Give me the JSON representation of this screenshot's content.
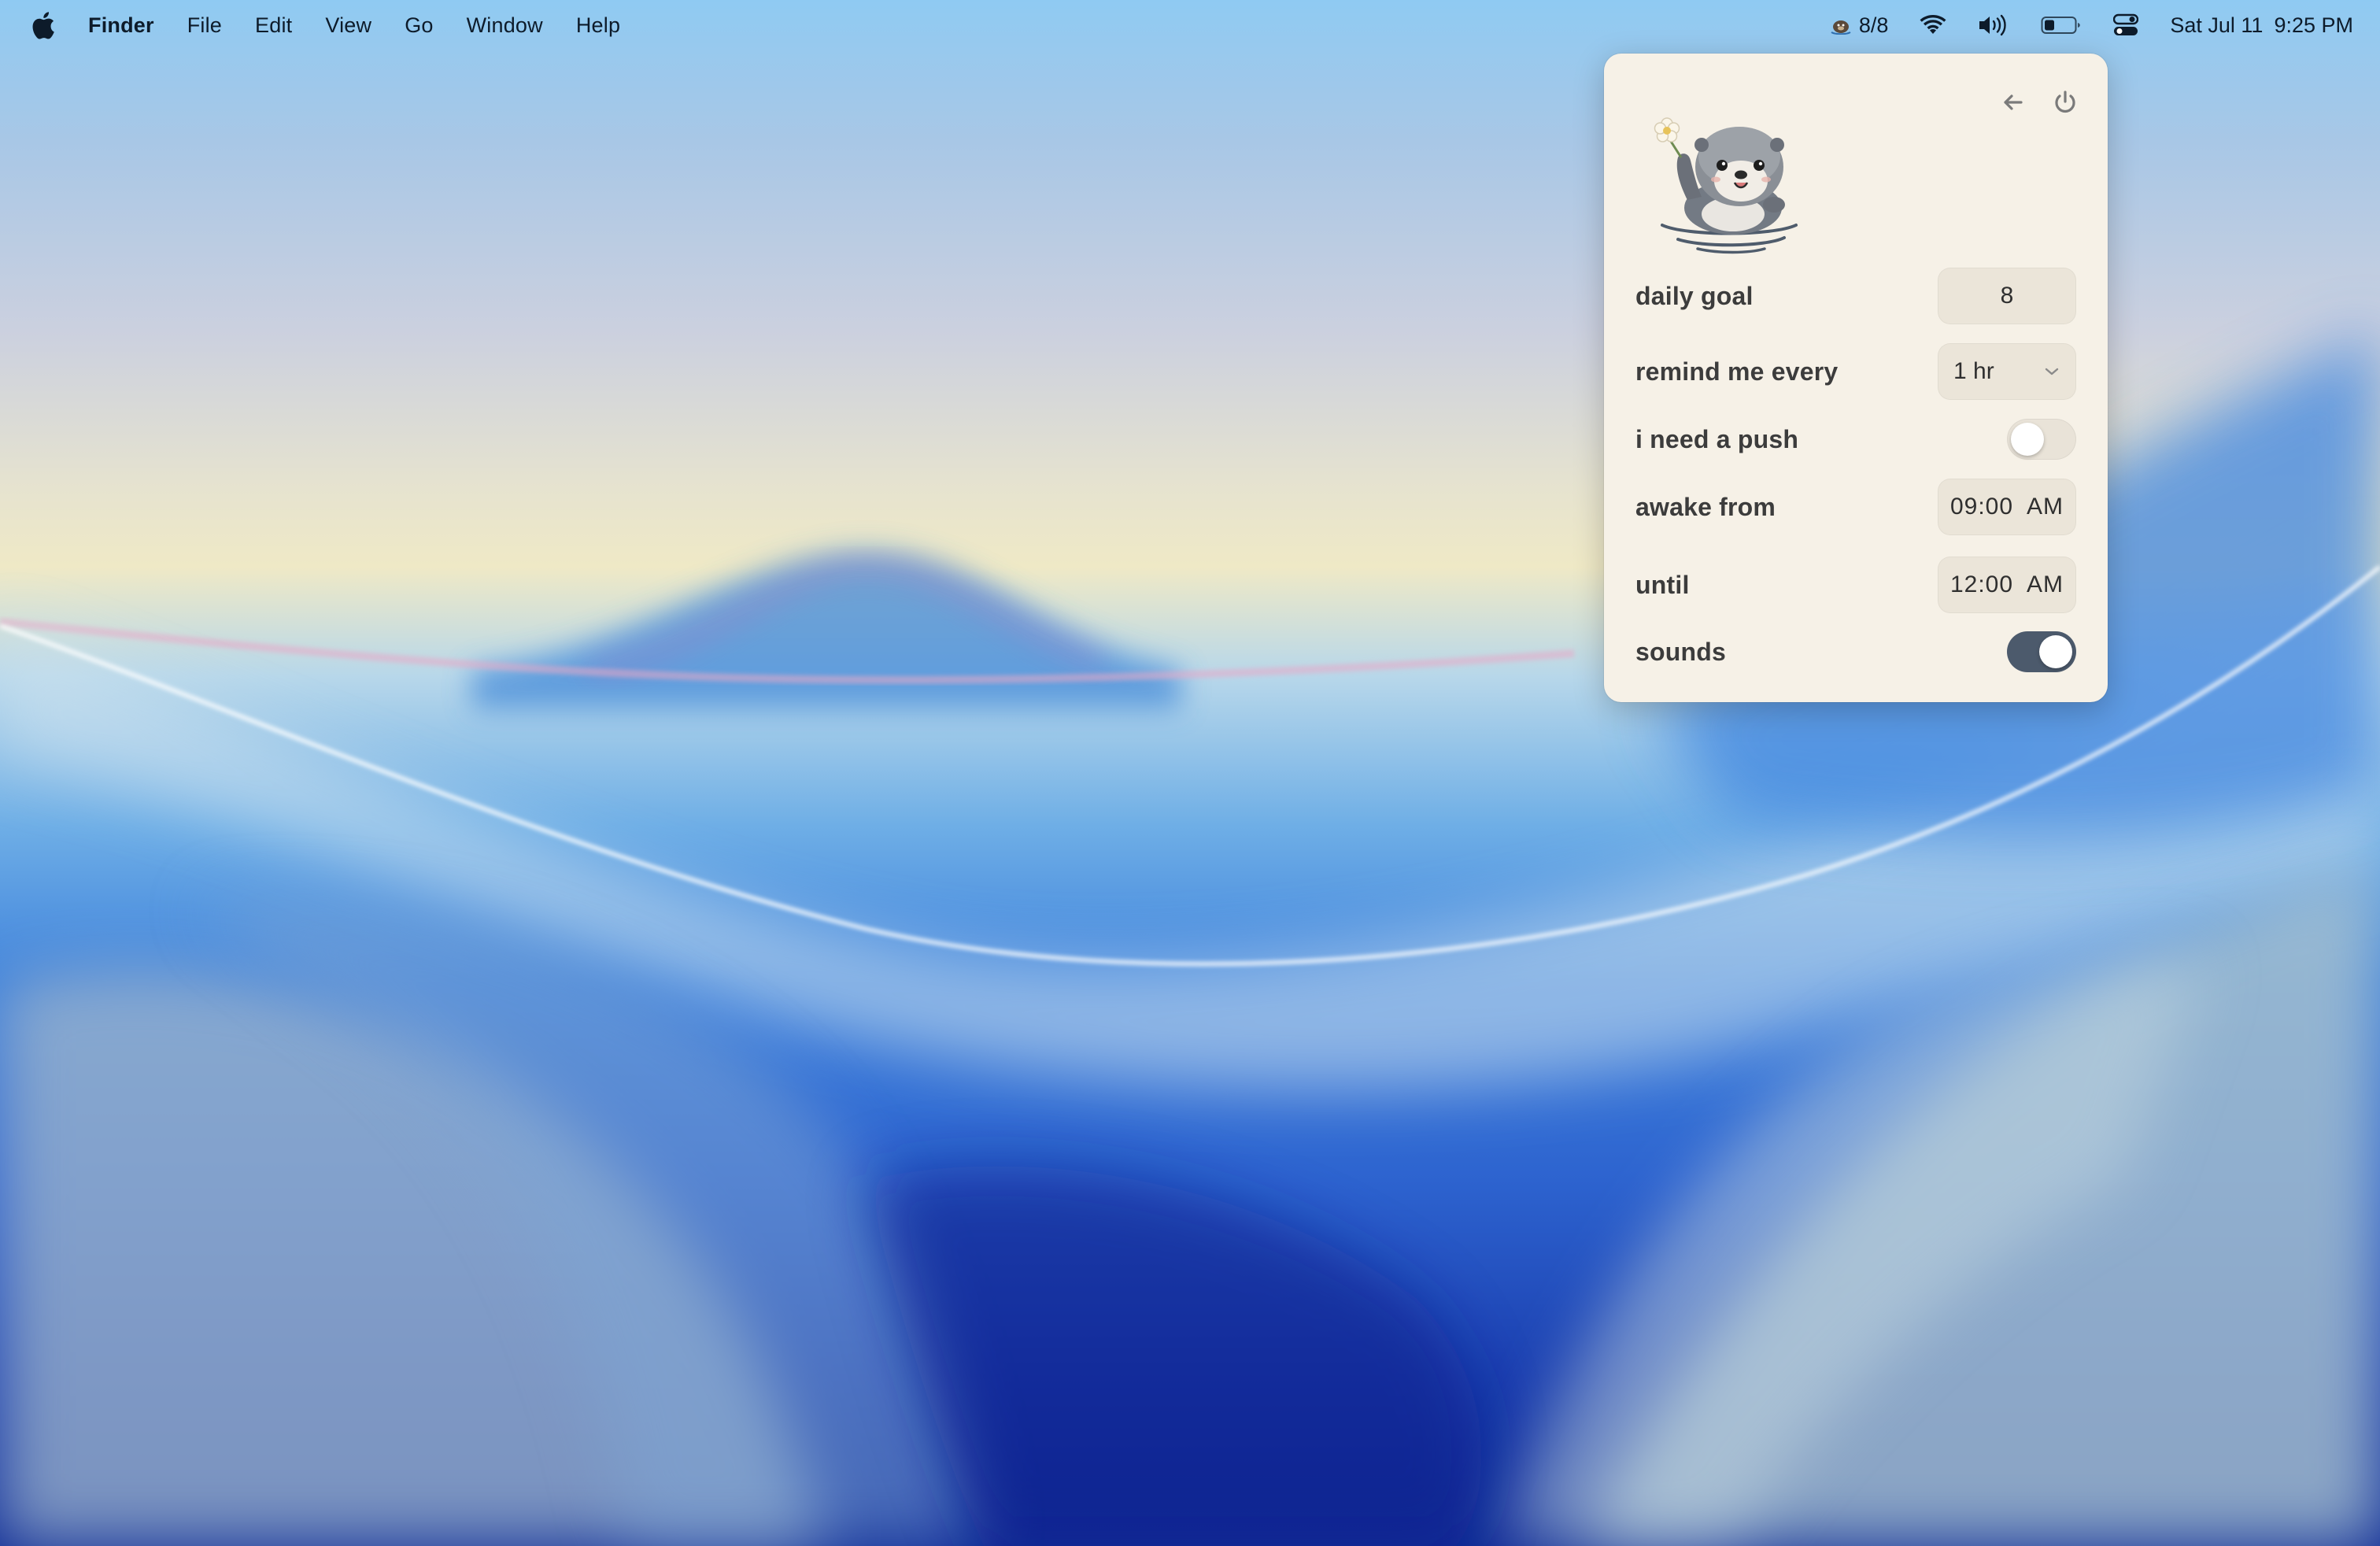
{
  "menubar": {
    "app_name": "Finder",
    "menus": [
      "File",
      "Edit",
      "View",
      "Go",
      "Window",
      "Help"
    ],
    "status_counter": "8/8",
    "date": "Sat Jul 11",
    "time": "9:25 PM",
    "icons": [
      "apple-logo",
      "otter-icon",
      "wifi-icon",
      "volume-icon",
      "battery-icon",
      "control-center-icon"
    ]
  },
  "popover": {
    "mascot": "otter-with-flower",
    "header_icons": [
      "back-arrow-icon",
      "power-icon"
    ],
    "settings": {
      "daily_goal": {
        "label": "daily goal",
        "value": "8"
      },
      "remind": {
        "label": "remind me every",
        "value": "1 hr"
      },
      "push": {
        "label": "i need a push",
        "enabled": false
      },
      "awake_from": {
        "label": "awake from",
        "value": "09:00  AM"
      },
      "until": {
        "label": "until",
        "value": "12:00  AM"
      },
      "sounds": {
        "label": "sounds",
        "enabled": true
      }
    }
  },
  "colors": {
    "popover_bg": "#f6f1e7",
    "field_bg": "#ebe5d9",
    "toggle_on": "#4c5a6c",
    "toggle_off": "#e9e3d8",
    "label_text": "#3c3c3c"
  }
}
